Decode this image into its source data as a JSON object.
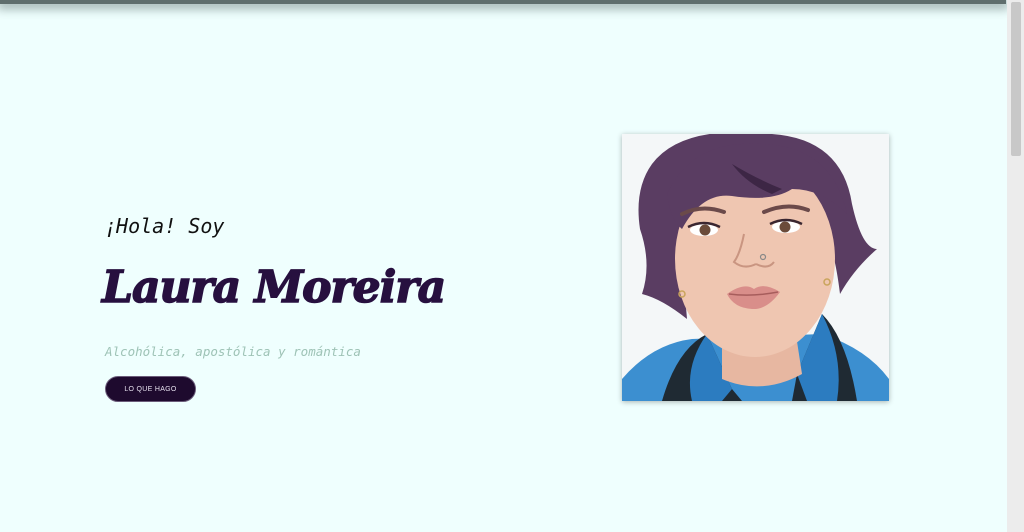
{
  "hero": {
    "greeting": "¡Hola! Soy",
    "name": "Laura Moreira",
    "tagline": "Alcohólica, apostólica y romántica",
    "cta_label": "LO QUE HAGO",
    "portrait_icon": "illustrated-portrait"
  },
  "colors": {
    "background": "#effffe",
    "name": "#27103f",
    "tagline": "#9ec3b6",
    "button_bg": "#1e0a2e"
  }
}
